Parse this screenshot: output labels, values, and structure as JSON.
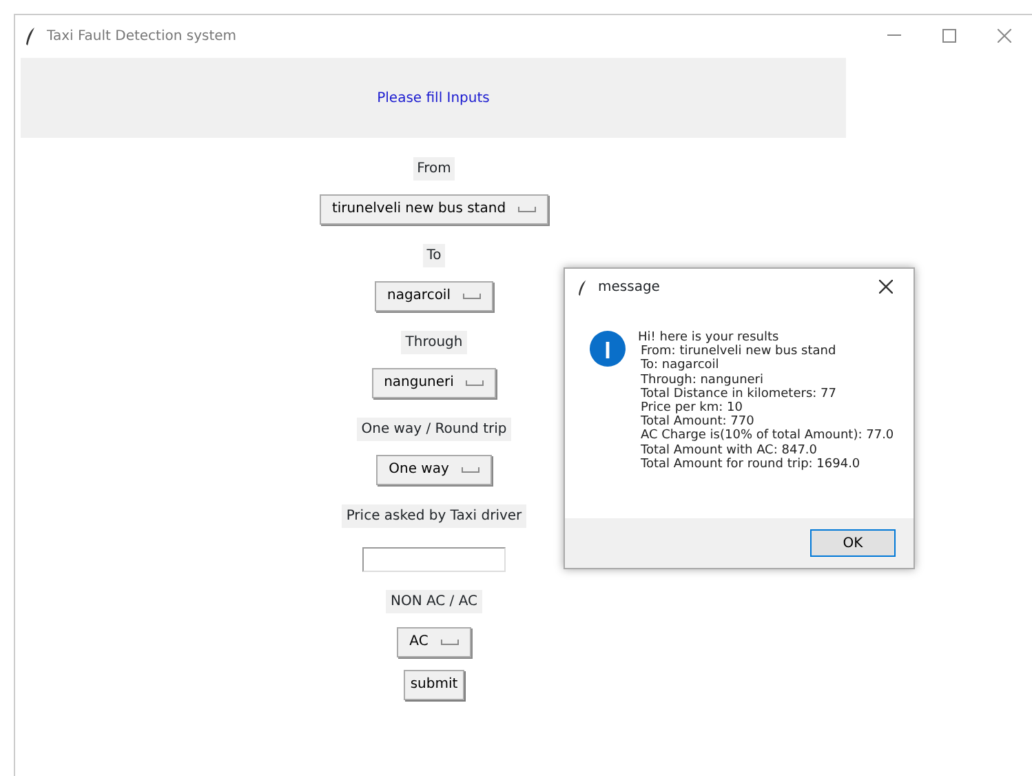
{
  "window": {
    "title": "Taxi Fault Detection system"
  },
  "header": "Please fill Inputs",
  "form": [
    {
      "kind": "label",
      "text": "From"
    },
    {
      "kind": "dropdown",
      "text": "tirunelveli new bus stand"
    },
    {
      "kind": "label",
      "text": "To"
    },
    {
      "kind": "dropdown",
      "text": "nagarcoil"
    },
    {
      "kind": "label",
      "text": "Through"
    },
    {
      "kind": "dropdown",
      "text": "nanguneri"
    },
    {
      "kind": "label",
      "text": "One way / Round trip"
    },
    {
      "kind": "dropdown",
      "text": "One way"
    },
    {
      "kind": "label",
      "text": "Price asked by Taxi driver"
    },
    {
      "kind": "entry"
    },
    {
      "kind": "label",
      "text": "NON AC / AC"
    },
    {
      "kind": "dropdown",
      "text": "AC"
    },
    {
      "kind": "button",
      "text": "submit"
    }
  ],
  "dialog": {
    "title": "message",
    "lines": [
      "Hi! here is your results",
      "From: tirunelveli new bus stand",
      "To: nagarcoil",
      "Through: nanguneri",
      "Total Distance in kilometers: 77",
      "Price per km: 10",
      "Total Amount: 770",
      "AC Charge is(10% of total Amount): 77.0",
      "Total Amount with AC: 847.0",
      "Total Amount for round trip: 1694.0"
    ],
    "button": "OK"
  }
}
